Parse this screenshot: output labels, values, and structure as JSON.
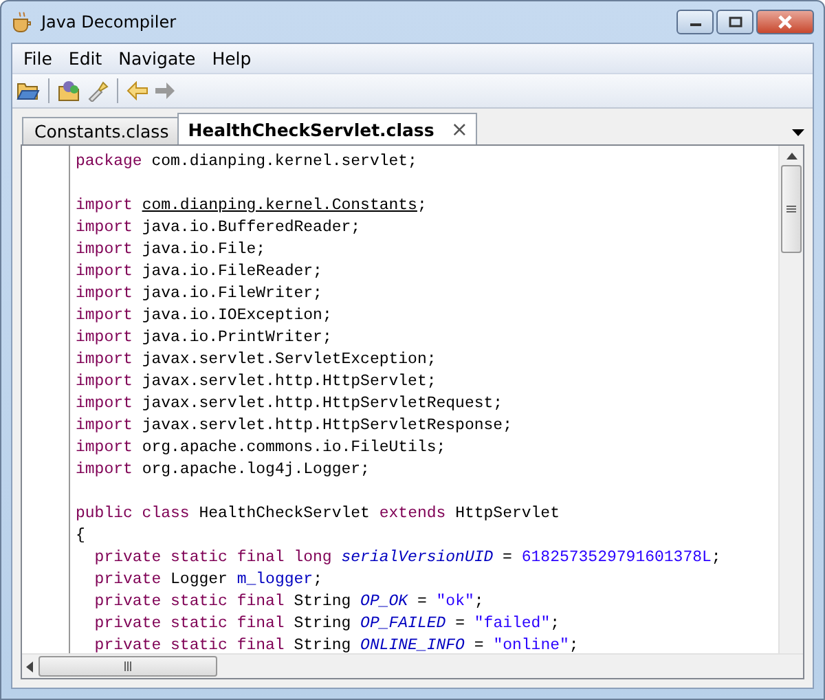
{
  "window": {
    "title": "Java Decompiler"
  },
  "menu": [
    "File",
    "Edit",
    "Navigate",
    "Help"
  ],
  "tabs": [
    {
      "label": "Constants.class",
      "selected": false
    },
    {
      "label": "HealthCheckServlet.class",
      "selected": true
    }
  ],
  "tab_close": "×",
  "code": [
    {
      "kind": "code",
      "segments": [
        {
          "kind": "keyword",
          "text": "package"
        },
        {
          "kind": "plain",
          "text": " com.dianping.kernel.servlet;"
        }
      ]
    },
    {
      "kind": "blank"
    },
    {
      "kind": "code",
      "segments": [
        {
          "kind": "keyword",
          "text": "import "
        },
        {
          "kind": "link",
          "text": "com.dianping.kernel.Constants"
        },
        {
          "kind": "plain",
          "text": ";"
        }
      ]
    },
    {
      "kind": "code",
      "segments": [
        {
          "kind": "keyword",
          "text": "import"
        },
        {
          "kind": "plain",
          "text": " java.io.BufferedReader;"
        }
      ]
    },
    {
      "kind": "code",
      "segments": [
        {
          "kind": "keyword",
          "text": "import"
        },
        {
          "kind": "plain",
          "text": " java.io.File;"
        }
      ]
    },
    {
      "kind": "code",
      "segments": [
        {
          "kind": "keyword",
          "text": "import"
        },
        {
          "kind": "plain",
          "text": " java.io.FileReader;"
        }
      ]
    },
    {
      "kind": "code",
      "segments": [
        {
          "kind": "keyword",
          "text": "import"
        },
        {
          "kind": "plain",
          "text": " java.io.FileWriter;"
        }
      ]
    },
    {
      "kind": "code",
      "segments": [
        {
          "kind": "keyword",
          "text": "import"
        },
        {
          "kind": "plain",
          "text": " java.io.IOException;"
        }
      ]
    },
    {
      "kind": "code",
      "segments": [
        {
          "kind": "keyword",
          "text": "import"
        },
        {
          "kind": "plain",
          "text": " java.io.PrintWriter;"
        }
      ]
    },
    {
      "kind": "code",
      "segments": [
        {
          "kind": "keyword",
          "text": "import"
        },
        {
          "kind": "plain",
          "text": " javax.servlet.ServletException;"
        }
      ]
    },
    {
      "kind": "code",
      "segments": [
        {
          "kind": "keyword",
          "text": "import"
        },
        {
          "kind": "plain",
          "text": " javax.servlet.http.HttpServlet;"
        }
      ]
    },
    {
      "kind": "code",
      "segments": [
        {
          "kind": "keyword",
          "text": "import"
        },
        {
          "kind": "plain",
          "text": " javax.servlet.http.HttpServletRequest;"
        }
      ]
    },
    {
      "kind": "code",
      "segments": [
        {
          "kind": "keyword",
          "text": "import"
        },
        {
          "kind": "plain",
          "text": " javax.servlet.http.HttpServletResponse;"
        }
      ]
    },
    {
      "kind": "code",
      "segments": [
        {
          "kind": "keyword",
          "text": "import"
        },
        {
          "kind": "plain",
          "text": " org.apache.commons.io.FileUtils;"
        }
      ]
    },
    {
      "kind": "code",
      "segments": [
        {
          "kind": "keyword",
          "text": "import"
        },
        {
          "kind": "plain",
          "text": " org.apache.log4j.Logger;"
        }
      ]
    },
    {
      "kind": "blank"
    },
    {
      "kind": "code",
      "segments": [
        {
          "kind": "keyword",
          "text": "public class"
        },
        {
          "kind": "plain",
          "text": " HealthCheckServlet "
        },
        {
          "kind": "keyword",
          "text": "extends"
        },
        {
          "kind": "plain",
          "text": " HttpServlet"
        }
      ]
    },
    {
      "kind": "code",
      "segments": [
        {
          "kind": "plain",
          "text": "{"
        }
      ]
    },
    {
      "kind": "code",
      "segments": [
        {
          "kind": "keyword",
          "text": "  private static final long "
        },
        {
          "kind": "field",
          "text": "serialVersionUID"
        },
        {
          "kind": "plain",
          "text": " = "
        },
        {
          "kind": "literal",
          "text": "6182573529791601378L"
        },
        {
          "kind": "plain",
          "text": ";"
        }
      ]
    },
    {
      "kind": "code",
      "segments": [
        {
          "kind": "keyword",
          "text": "  private"
        },
        {
          "kind": "plain",
          "text": " Logger "
        },
        {
          "kind": "member",
          "text": "m_logger"
        },
        {
          "kind": "plain",
          "text": ";"
        }
      ]
    },
    {
      "kind": "code",
      "segments": [
        {
          "kind": "keyword",
          "text": "  private static final"
        },
        {
          "kind": "plain",
          "text": " String "
        },
        {
          "kind": "field",
          "text": "OP_OK"
        },
        {
          "kind": "plain",
          "text": " = "
        },
        {
          "kind": "literal",
          "text": "\"ok\""
        },
        {
          "kind": "plain",
          "text": ";"
        }
      ]
    },
    {
      "kind": "code",
      "segments": [
        {
          "kind": "keyword",
          "text": "  private static final"
        },
        {
          "kind": "plain",
          "text": " String "
        },
        {
          "kind": "field",
          "text": "OP_FAILED"
        },
        {
          "kind": "plain",
          "text": " = "
        },
        {
          "kind": "literal",
          "text": "\"failed\""
        },
        {
          "kind": "plain",
          "text": ";"
        }
      ]
    },
    {
      "kind": "code",
      "segments": [
        {
          "kind": "keyword",
          "text": "  private static final"
        },
        {
          "kind": "plain",
          "text": " String "
        },
        {
          "kind": "field",
          "text": "ONLINE_INFO"
        },
        {
          "kind": "plain",
          "text": " = "
        },
        {
          "kind": "literal",
          "text": "\"online\""
        },
        {
          "kind": "plain",
          "text": ";"
        }
      ]
    }
  ]
}
